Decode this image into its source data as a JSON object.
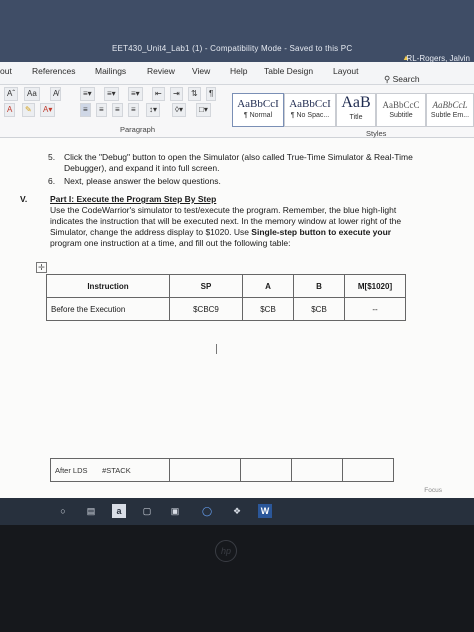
{
  "titlebar": {
    "title": "EET430_Unit4_Lab1 (1) - Compatibility Mode - Saved to this PC",
    "user": "RL-Rogers, Jalvin"
  },
  "tabs": [
    "out",
    "References",
    "Mailings",
    "Review",
    "View",
    "Help",
    "Table Design",
    "Layout"
  ],
  "search_label": "Search",
  "ribbon": {
    "font_size_label": "Aa",
    "paragraph_label": "Paragraph",
    "styles_label": "Styles",
    "styles": [
      {
        "sample": "AaBbCcI",
        "name": "¶ Normal"
      },
      {
        "sample": "AaBbCcI",
        "name": "¶ No Spac..."
      },
      {
        "sample": "AaB",
        "name": "Title"
      },
      {
        "sample": "AaBbCcC",
        "name": "Subtitle"
      },
      {
        "sample": "AaBbCcL",
        "name": "Subtle Em..."
      }
    ]
  },
  "document": {
    "step5_num": "5.",
    "step5_line1": "Click the \"Debug\" button to open the Simulator (also called True-Time Simulator & Real-Time",
    "step5_line2": "Debugger), and expand it into full screen.",
    "step6_num": "6.",
    "step6": "Next, please answer the below questions.",
    "section_num": "V.",
    "part_title": "Part I: Execute the Program Step By Step",
    "para_line1": "Use the CodeWarrior's simulator to test/execute the program. Remember, the blue high-light",
    "para_line2": "indicates the instruction that will be executed next. In the memory window at lower right of the",
    "para_line3_a": "Simulator, change the address display to $1020. Use ",
    "para_line3_b": "Single-step button to execute your",
    "para_line4": "program one instruction at a time, and fill out the following table:",
    "table_headers": [
      "Instruction",
      "SP",
      "A",
      "B",
      "M[$1020]"
    ],
    "table_row": [
      "Before the Execution",
      "$CBC9",
      "$CB",
      "$CB",
      "--"
    ],
    "lower_row": [
      "After LDS",
      "#STACK"
    ],
    "focus_label": "Focus"
  },
  "colors": {
    "titlebar": "#3f4d66",
    "taskbar": "#27303d",
    "word_blue": "#2b579a"
  }
}
